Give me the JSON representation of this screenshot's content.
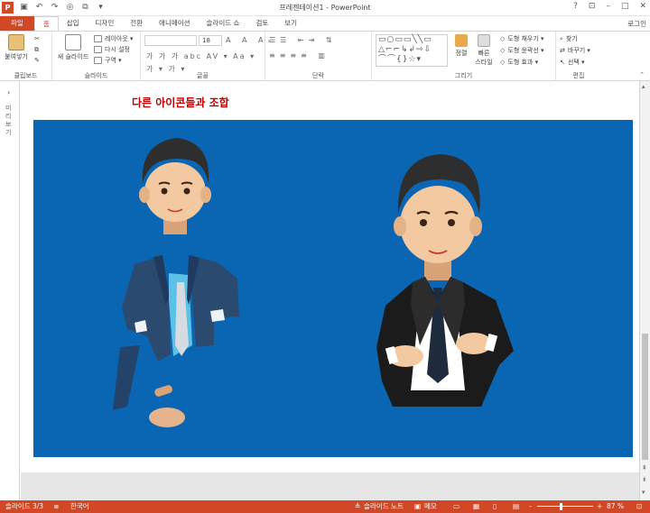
{
  "window": {
    "title": "프레젠테이션1 - PowerPoint",
    "signin": "로그인"
  },
  "qat": {
    "icons": [
      "powerpoint-logo-icon",
      "save-icon",
      "undo-icon",
      "redo-icon",
      "repeat-icon",
      "start-slideshow-icon",
      "customize-icon"
    ]
  },
  "tabs": [
    "파일",
    "홈",
    "삽입",
    "디자인",
    "전환",
    "애니메이션",
    "슬라이드 쇼",
    "검토",
    "보기"
  ],
  "active_tab": "홈",
  "ribbon": {
    "clipboard": {
      "paste": "붙여넣기",
      "label": "클립보드"
    },
    "slides": {
      "new_slide": "새 슬라이드",
      "layout": "레이아웃 ▾",
      "reset": "다시 설정",
      "section": "구역 ▾",
      "label": "슬라이드"
    },
    "font": {
      "font_size": "18",
      "label": "글꼴",
      "row1": "A  A  Aₓ",
      "row2": "가  가  가  abc  AV ▾  Aa ▾",
      "row3": "가 ▾  가 ▾"
    },
    "paragraph": {
      "label": "단락"
    },
    "drawing": {
      "arrange": "정렬",
      "quick_styles": "빠른 스타일",
      "fill": "도형 채우기 ▾",
      "outline": "도형 윤곽선 ▾",
      "effects": "도형 효과 ▾",
      "label": "그리기"
    },
    "editing": {
      "find": "찾기",
      "replace": "바꾸기 ▾",
      "select": "선택 ▾",
      "label": "편집"
    }
  },
  "thumbnails": {
    "vertical_label": "미리보기"
  },
  "slide": {
    "title": "다른 아이콘들과 조합"
  },
  "status": {
    "slide_num": "슬라이드 3/3",
    "language": "한국어",
    "notes": "슬라이드 노트",
    "comments": "메모",
    "zoom": "87 %",
    "zoom_minus": "-",
    "zoom_plus": "+"
  },
  "colors": {
    "accent": "#d24726",
    "slide_bg": "#0a66b3",
    "title_red": "#c00000"
  }
}
